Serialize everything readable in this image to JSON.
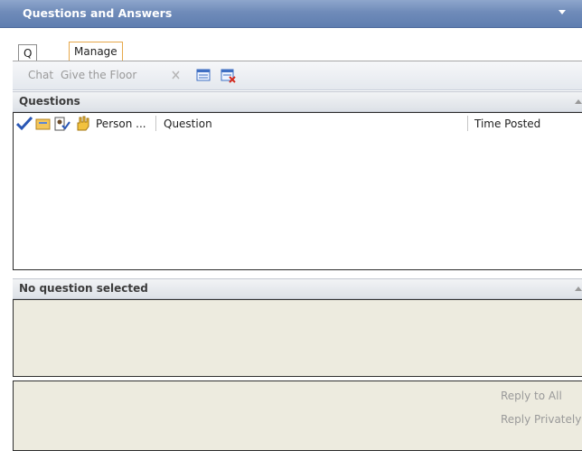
{
  "window": {
    "title": "Questions and Answers",
    "menu_icon": "chevron-down-icon"
  },
  "tabs": [
    {
      "label": "Q & A",
      "active": false
    },
    {
      "label": "Manage",
      "active": true
    }
  ],
  "toolbar": {
    "chat_label": "Chat",
    "give_floor_label": "Give the Floor",
    "icons": [
      "delete-x-icon",
      "list-view-icon",
      "clear-list-icon"
    ]
  },
  "questions_section": {
    "title": "Questions",
    "columns": {
      "icons": [
        "checkmark-icon",
        "folder-icon",
        "person-check-icon",
        "hand-raise-icon"
      ],
      "person": "Person ...",
      "question": "Question",
      "time_posted": "Time Posted"
    },
    "rows": []
  },
  "detail_section": {
    "title": "No question selected"
  },
  "reply": {
    "reply_all_label": "Reply to All",
    "reply_private_label": "Reply Privately"
  },
  "colors": {
    "title_bar": "#6f8bb9",
    "active_tab_border": "#e6a84b",
    "panel_background": "#edebdf",
    "disabled_text": "#9a9a9a"
  }
}
